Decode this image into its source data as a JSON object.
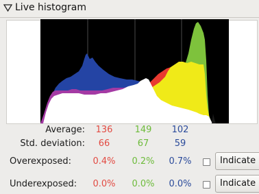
{
  "panel": {
    "title": "Live histogram"
  },
  "stats": {
    "average_label": "Average:",
    "average": {
      "r": "136",
      "g": "149",
      "b": "102"
    },
    "std_label": "Std. deviation:",
    "std": {
      "r": "66",
      "g": "67",
      "b": "59"
    }
  },
  "overexposed": {
    "label": "Overexposed:",
    "r": "0.4%",
    "g": "0.2%",
    "b": "0.7%",
    "button_label": "Indicate"
  },
  "underexposed": {
    "label": "Underexposed:",
    "r": "0.0%",
    "g": "0.0%",
    "b": "0.0%",
    "button_label": "Indicate"
  },
  "colors": {
    "red": "#e24a42",
    "green": "#6dbb3b",
    "blue": "#2a4a9a",
    "histogram_bg": "#000000"
  }
}
